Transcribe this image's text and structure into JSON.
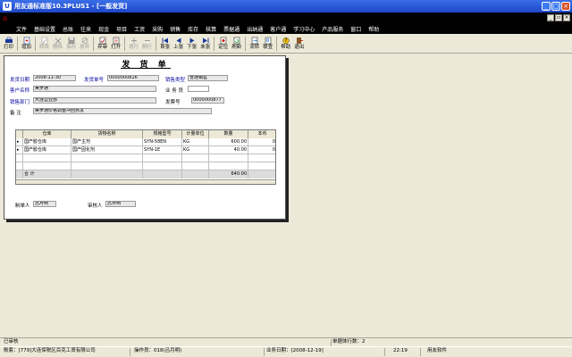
{
  "window": {
    "title": "用友通标准版10.3PLUS1 - [一般发货]"
  },
  "menu": [
    "文件",
    "基础设置",
    "总账",
    "往来",
    "现金",
    "项目",
    "工资",
    "采购",
    "销售",
    "库存",
    "核算",
    "票据通",
    "出纳通",
    "客户通",
    "学习中心",
    "产品服务",
    "窗口",
    "帮助"
  ],
  "toolbar": [
    {
      "label": "打印",
      "icon": "printer-icon",
      "enabled": true
    },
    {
      "label": "增加",
      "icon": "add-icon",
      "enabled": true
    },
    {
      "label": "修改",
      "icon": "edit-icon",
      "enabled": false
    },
    {
      "label": "删除",
      "icon": "delete-icon",
      "enabled": false
    },
    {
      "label": "保存",
      "icon": "save-icon",
      "enabled": false
    },
    {
      "label": "放弃",
      "icon": "cancel-icon",
      "enabled": false
    },
    {
      "label": "弃审",
      "icon": "unaudit-icon",
      "enabled": true
    },
    {
      "label": "打开",
      "icon": "open-icon",
      "enabled": true
    },
    {
      "label": "增行",
      "icon": "add-row-icon",
      "enabled": false
    },
    {
      "label": "删行",
      "icon": "delete-row-icon",
      "enabled": false
    },
    {
      "label": "首张",
      "icon": "first-icon",
      "enabled": true
    },
    {
      "label": "上张",
      "icon": "prev-icon",
      "enabled": true
    },
    {
      "label": "下张",
      "icon": "next-icon",
      "enabled": true
    },
    {
      "label": "末张",
      "icon": "last-icon",
      "enabled": true
    },
    {
      "label": "定位",
      "icon": "locate-icon",
      "enabled": true
    },
    {
      "label": "刷新",
      "icon": "refresh-icon",
      "enabled": true
    },
    {
      "label": "流转",
      "icon": "flow-icon",
      "enabled": true
    },
    {
      "label": "联查",
      "icon": "link-query-icon",
      "enabled": true
    },
    {
      "label": "帮助",
      "icon": "help-icon",
      "enabled": true
    },
    {
      "label": "退出",
      "icon": "exit-icon",
      "enabled": true
    }
  ],
  "form": {
    "title": "发 货 单",
    "ship_date_label": "发货日期",
    "ship_date": "2008-11-30",
    "ship_no_label": "发货单号",
    "ship_no": "0000000826",
    "sales_type_label": "销售类型",
    "sales_type": "普通销售",
    "customer_label": "客户名称",
    "customer": "美罗通",
    "salesman_label": "业 务 员",
    "salesman": "",
    "dept_label": "销售部门",
    "dept": "大连营业部",
    "invoice_no_label": "发票号",
    "invoice_no": "0000000877",
    "remark_label": "备    注",
    "remark": "美罗通价格调整冲回另发"
  },
  "grid": {
    "headers": [
      "仓库",
      "货物名称",
      "规格型号",
      "计量单位",
      "数量",
      "本币"
    ],
    "rows": [
      {
        "warehouse": "国产胶仓库",
        "goods": "国产主剂",
        "spec": "SYN-58EN",
        "unit": "KG",
        "qty": "600.00",
        "amt": "0"
      },
      {
        "warehouse": "国产胶仓库",
        "goods": "国产固化剂",
        "spec": "SYN-1E",
        "unit": "KG",
        "qty": "40.00",
        "amt": "0"
      }
    ],
    "total_label": "合  计",
    "total_qty": "640.00"
  },
  "footer": {
    "maker_label": "制单人",
    "maker": "吕月明",
    "auditor_label": "审核人",
    "auditor": "吕月明"
  },
  "status": {
    "audited": "已审核",
    "rows_label": "单据体行数：2",
    "account": "账套：[779]大连保税区百克工贸有限公司",
    "operator": "操作员：018(吕月明)",
    "biz_date": "业务日期：[2008-12-19]",
    "time": "22:19",
    "software": "用友软件"
  }
}
